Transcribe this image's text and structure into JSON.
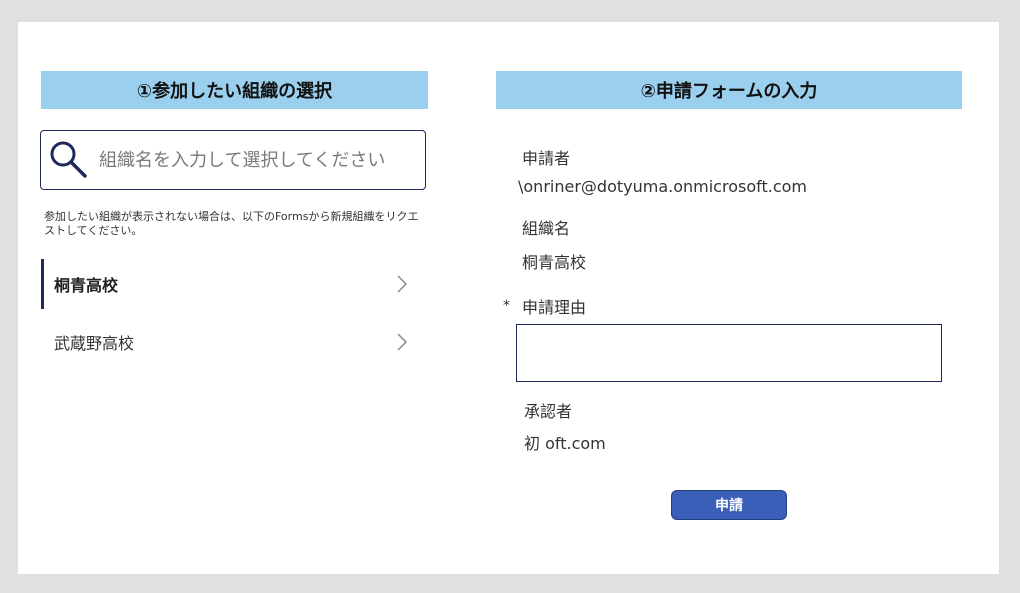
{
  "left_panel": {
    "title": "①参加したい組織の選択",
    "search": {
      "placeholder": "組織名を入力して選択してください",
      "value": ""
    },
    "note": "参加したい組織が表示されない場合は、以下のFormsから新規組織をリクエストしてください。",
    "organizations": [
      {
        "name": "桐青高校",
        "selected": true
      },
      {
        "name": "武蔵野高校",
        "selected": false
      }
    ]
  },
  "right_panel": {
    "title": "②申請フォームの入力",
    "applicant_label": "申請者",
    "applicant_value": "\\onriner@dotyuma.onmicrosoft.com",
    "organization_label": "組織名",
    "organization_value": "桐青高校",
    "required_mark": "*",
    "reason_label": "申請理由",
    "reason_value": "",
    "approver_label": "承認者",
    "approver_value": "初                          oft.com",
    "submit_label": "申請"
  },
  "colors": {
    "header_bg": "#9bcfee",
    "accent": "#1f2a5c",
    "button_bg": "#3b5eb8",
    "frame_bg": "#e0e0e0"
  }
}
